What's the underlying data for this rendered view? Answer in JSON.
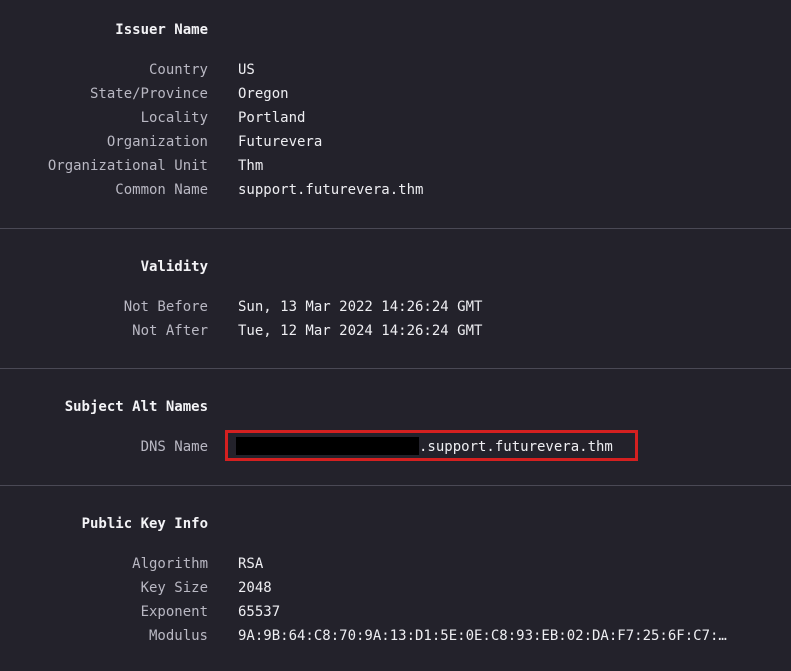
{
  "issuer": {
    "title": "Issuer Name",
    "rows": [
      {
        "label": "Country",
        "value": "US"
      },
      {
        "label": "State/Province",
        "value": "Oregon"
      },
      {
        "label": "Locality",
        "value": "Portland"
      },
      {
        "label": "Organization",
        "value": "Futurevera"
      },
      {
        "label": "Organizational Unit",
        "value": "Thm"
      },
      {
        "label": "Common Name",
        "value": "support.futurevera.thm"
      }
    ]
  },
  "validity": {
    "title": "Validity",
    "rows": [
      {
        "label": "Not Before",
        "value": "Sun, 13 Mar 2022 14:26:24 GMT"
      },
      {
        "label": "Not After",
        "value": "Tue, 12 Mar 2024 14:26:24 GMT"
      }
    ]
  },
  "san": {
    "title": "Subject Alt Names",
    "dns_label": "DNS Name",
    "dns_value_suffix": ".support.futurevera.thm"
  },
  "public_key": {
    "title": "Public Key Info",
    "rows": [
      {
        "label": "Algorithm",
        "value": "RSA"
      },
      {
        "label": "Key Size",
        "value": "2048"
      },
      {
        "label": "Exponent",
        "value": "65537"
      },
      {
        "label": "Modulus",
        "value": "9A:9B:64:C8:70:9A:13:D1:5E:0E:C8:93:EB:02:DA:F7:25:6F:C7:…"
      }
    ]
  },
  "colors": {
    "background": "#23222b",
    "divider": "#4a4955",
    "highlight_border": "#d42020",
    "redaction": "#000000"
  }
}
